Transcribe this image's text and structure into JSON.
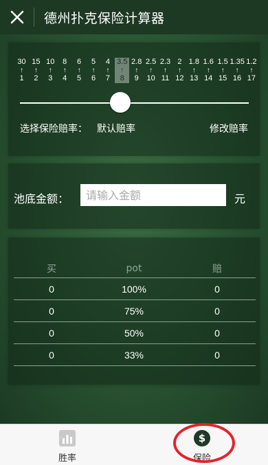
{
  "header": {
    "title": "德州扑克保险计算器",
    "close_icon": "close-icon"
  },
  "odds": [
    {
      "payout": "30",
      "outs": "1"
    },
    {
      "payout": "15",
      "outs": "2"
    },
    {
      "payout": "10",
      "outs": "3"
    },
    {
      "payout": "8",
      "outs": "4"
    },
    {
      "payout": "6",
      "outs": "5"
    },
    {
      "payout": "5",
      "outs": "6"
    },
    {
      "payout": "4",
      "outs": "7"
    },
    {
      "payout": "3.5",
      "outs": "8"
    },
    {
      "payout": "2.8",
      "outs": "9"
    },
    {
      "payout": "2.5",
      "outs": "10"
    },
    {
      "payout": "2.3",
      "outs": "11"
    },
    {
      "payout": "2",
      "outs": "12"
    },
    {
      "payout": "1.8",
      "outs": "13"
    },
    {
      "payout": "1.6",
      "outs": "14"
    },
    {
      "payout": "1.5",
      "outs": "15"
    },
    {
      "payout": "1.35",
      "outs": "16"
    },
    {
      "payout": "1.2",
      "outs": "17"
    }
  ],
  "selected_outs": "8",
  "rate": {
    "label": "选择保险赔率：",
    "default": "默认赔率",
    "edit": "修改赔率"
  },
  "pool": {
    "label": "池底金额：",
    "placeholder": "请输入金额",
    "unit": "元"
  },
  "table": {
    "headers": [
      "买",
      "pot",
      "赔"
    ],
    "rows": [
      [
        "0",
        "100%",
        "0"
      ],
      [
        "0",
        "75%",
        "0"
      ],
      [
        "0",
        "50%",
        "0"
      ],
      [
        "0",
        "33%",
        "0"
      ]
    ]
  },
  "tabs": [
    {
      "label": "胜率",
      "icon": "bar-chart-icon"
    },
    {
      "label": "保险",
      "icon": "dollar-circle-icon"
    }
  ],
  "colors": {
    "accent_highlight": "#e3242b",
    "background": "#2c5835"
  }
}
